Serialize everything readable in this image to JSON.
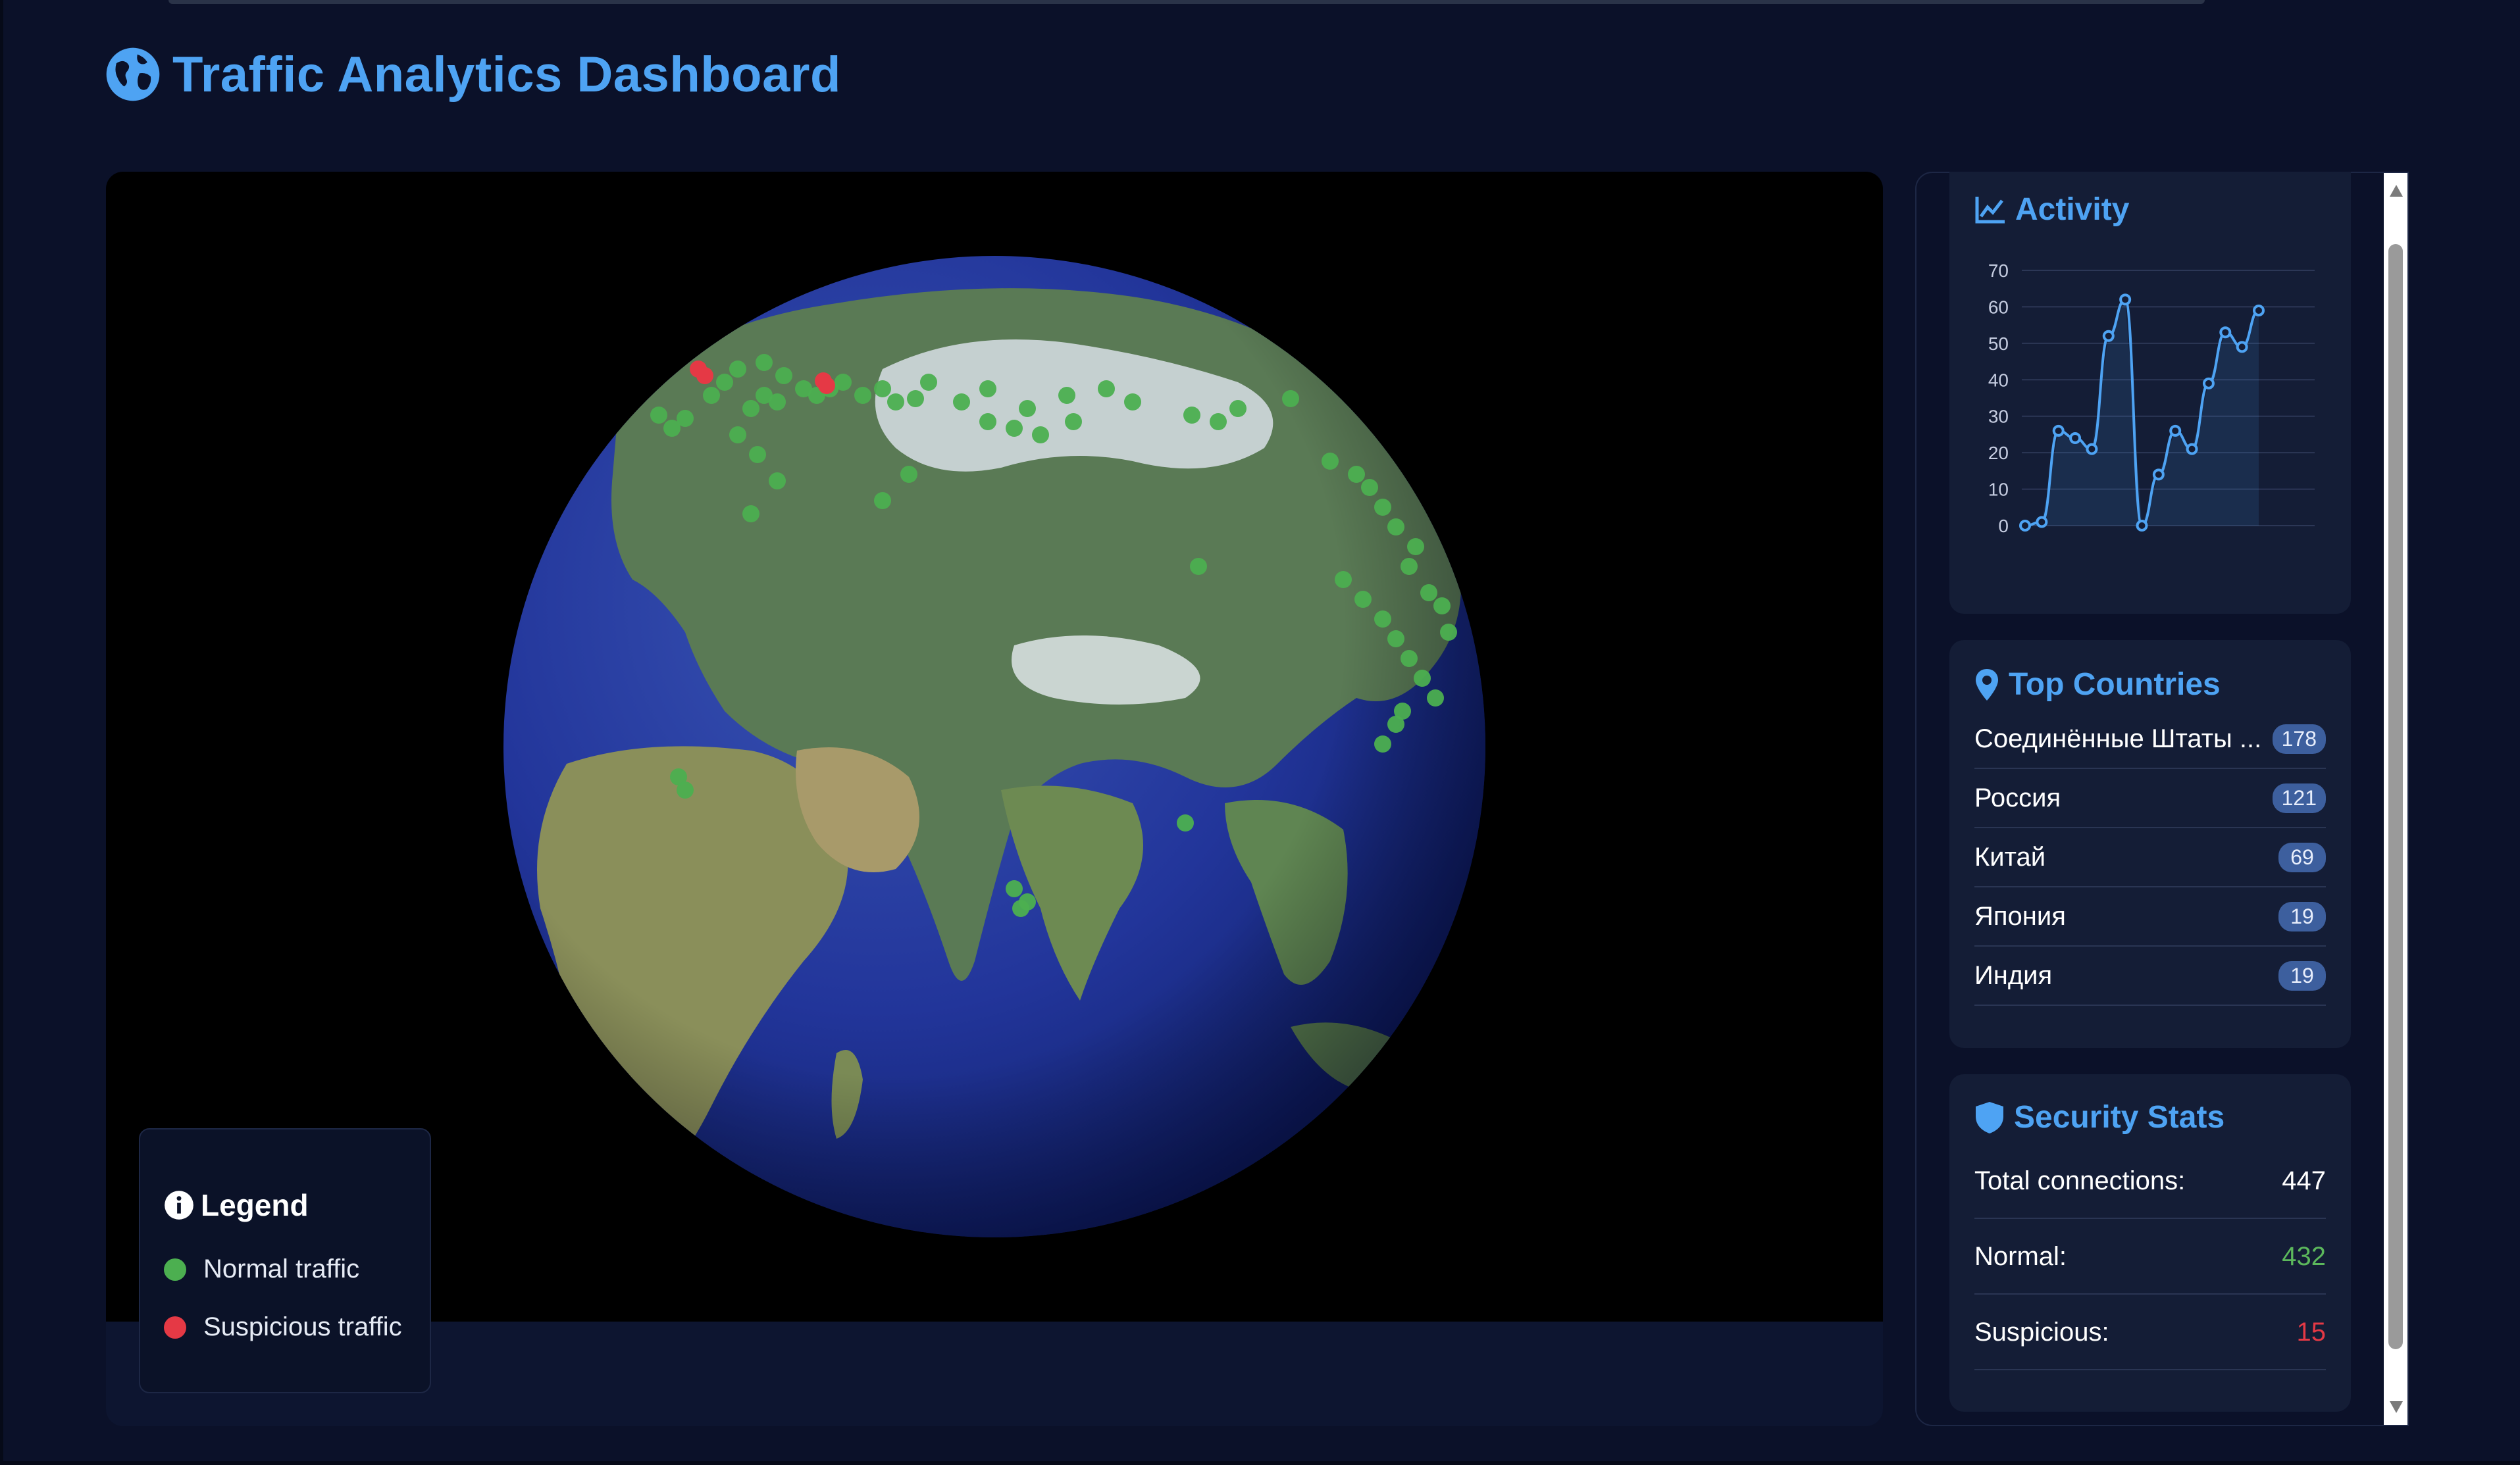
{
  "header": {
    "title": "Traffic Analytics Dashboard"
  },
  "legend": {
    "title": "Legend",
    "items": [
      {
        "label": "Normal traffic",
        "color": "#4caf50"
      },
      {
        "label": "Suspicious traffic",
        "color": "#e53945"
      }
    ]
  },
  "activity": {
    "title": "Activity",
    "chart_data": {
      "type": "area",
      "y_ticks": [
        "70",
        "60",
        "50",
        "40",
        "30",
        "20",
        "10",
        "0"
      ],
      "ylim": [
        0,
        70
      ],
      "values": [
        0,
        1,
        26,
        24,
        21,
        52,
        62,
        0,
        14,
        26,
        21,
        39,
        53,
        49,
        59
      ],
      "line_color": "#4ea3f3",
      "grid": true
    }
  },
  "top_countries": {
    "title": "Top Countries",
    "items": [
      {
        "name": "Соединённые Штаты ...",
        "count": "178"
      },
      {
        "name": "Россия",
        "count": "121"
      },
      {
        "name": "Китай",
        "count": "69"
      },
      {
        "name": "Япония",
        "count": "19"
      },
      {
        "name": "Индия",
        "count": "19"
      }
    ]
  },
  "security_stats": {
    "title": "Security Stats",
    "rows": [
      {
        "label": "Total connections:",
        "value": "447",
        "color": "#ffffff"
      },
      {
        "label": "Normal:",
        "value": "432",
        "color": "#5cb85c"
      },
      {
        "label": "Suspicious:",
        "value": "15",
        "color": "#e53945"
      }
    ]
  },
  "colors": {
    "accent": "#4ea3f3",
    "background": "#0b1129",
    "card": "#141d36",
    "normal": "#4caf50",
    "suspicious": "#e53945"
  }
}
